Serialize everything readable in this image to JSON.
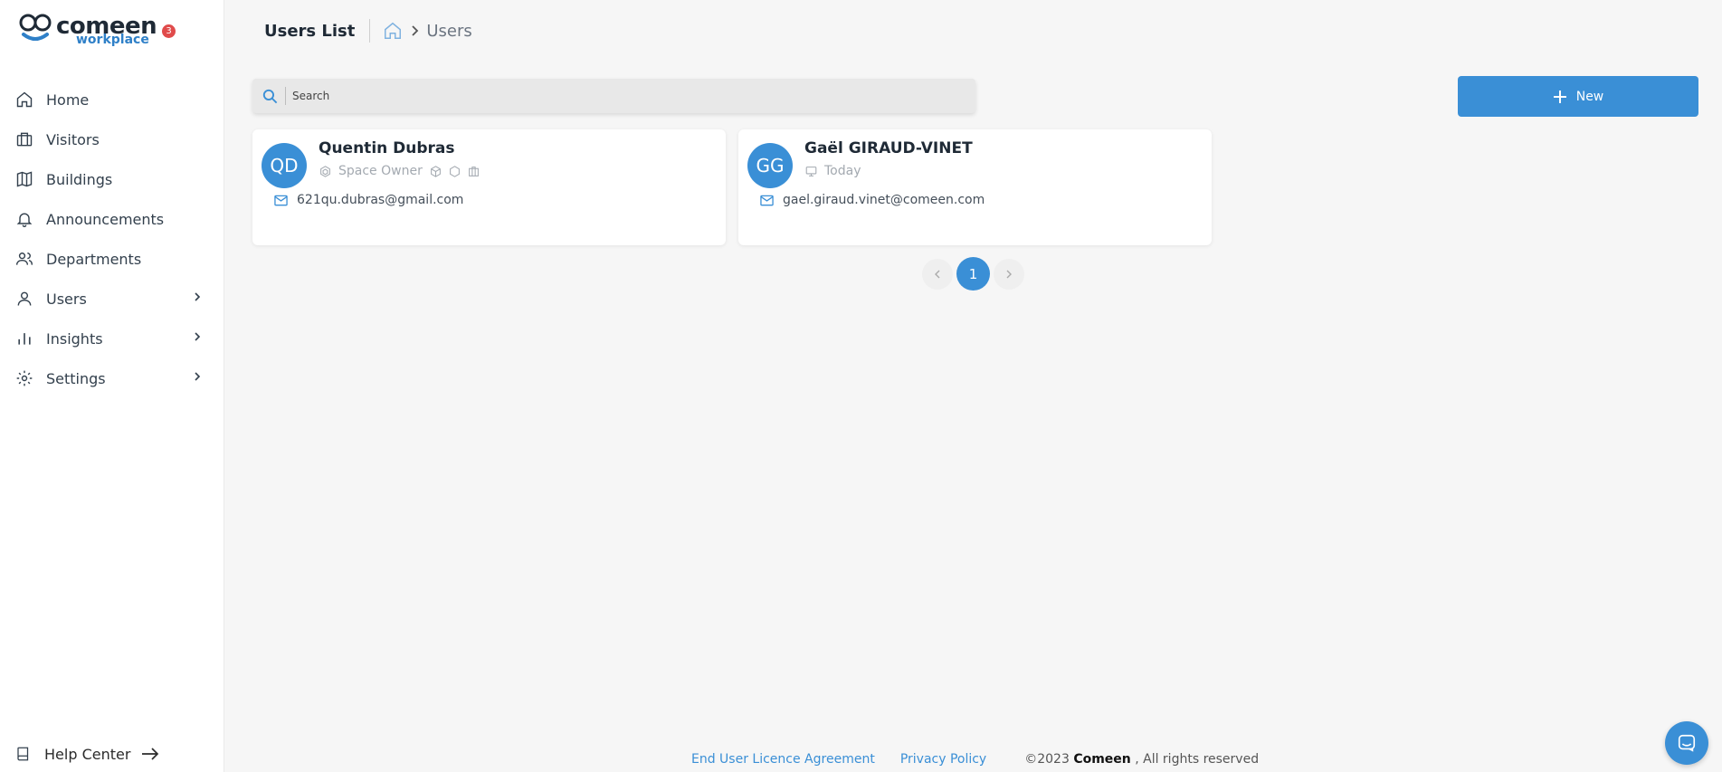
{
  "brand": {
    "word": "comeen",
    "sub": "workplace",
    "badge": "3"
  },
  "sidebar": {
    "items": [
      {
        "label": "Home",
        "icon": "home-icon",
        "has_children": false
      },
      {
        "label": "Visitors",
        "icon": "briefcase-icon",
        "has_children": false
      },
      {
        "label": "Buildings",
        "icon": "map-icon",
        "has_children": false
      },
      {
        "label": "Announcements",
        "icon": "bell-icon",
        "has_children": false
      },
      {
        "label": "Departments",
        "icon": "users-icon",
        "has_children": false
      },
      {
        "label": "Users",
        "icon": "user-icon",
        "has_children": true
      },
      {
        "label": "Insights",
        "icon": "bar-chart-icon",
        "has_children": true
      },
      {
        "label": "Settings",
        "icon": "gear-icon",
        "has_children": true
      }
    ],
    "help": {
      "label": "Help Center",
      "icon": "book-icon"
    }
  },
  "header": {
    "title": "Users List",
    "breadcrumb": {
      "home_icon": "home-icon",
      "current": "Users"
    }
  },
  "search": {
    "placeholder": "Search",
    "value": ""
  },
  "toolbar": {
    "new_label": "New"
  },
  "users": [
    {
      "initials": "QD",
      "name": "Quentin Dubras",
      "role": "Space Owner",
      "email": "621qu.dubras@gmail.com",
      "meta_icons": [
        "space-owner-icon",
        "cube-icon",
        "hexagon-icon",
        "building-icon"
      ]
    },
    {
      "initials": "GG",
      "name": "Gaël GIRAUD-VINET",
      "role": "Today",
      "email": "gael.giraud.vinet@comeen.com",
      "meta_icons": [
        "monitor-icon"
      ]
    }
  ],
  "pagination": {
    "current": "1"
  },
  "footer": {
    "eula": "End User Licence Agreement",
    "privacy": "Privacy Policy",
    "copyright_prefix": "©2023",
    "copyright_brand": "Comeen",
    "copyright_suffix": ", All rights reserved"
  },
  "colors": {
    "accent": "#3a8fd6",
    "badge": "#e04b4b",
    "text": "#33404d"
  }
}
